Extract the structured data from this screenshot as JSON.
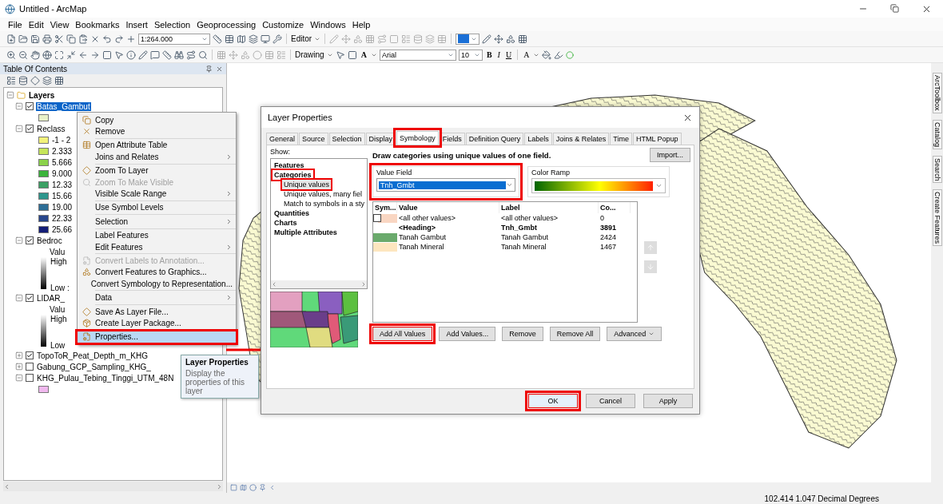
{
  "window": {
    "title": "Untitled - ArcMap"
  },
  "menu_bar": [
    "File",
    "Edit",
    "View",
    "Bookmarks",
    "Insert",
    "Selection",
    "Geoprocessing",
    "Customize",
    "Windows",
    "Help"
  ],
  "standard_toolbar": {
    "scale": "1:264.000",
    "editor": "Editor"
  },
  "drawing_toolbar": {
    "label": "Drawing",
    "text_tool": "A",
    "font": "Arial",
    "size": "10",
    "styles": [
      "B",
      "I",
      "U"
    ],
    "font_color": "A"
  },
  "toc": {
    "title": "Table Of Contents",
    "root": {
      "label": "Layers",
      "expanded": true,
      "children": [
        {
          "label": "Batas_Gambut",
          "checked": true,
          "expanded": true,
          "selected": true,
          "legend": [
            {
              "kind": "swatch",
              "color": "#e8f0c8"
            }
          ]
        },
        {
          "label": "Reclass",
          "checked": true,
          "expanded": true,
          "selected": false,
          "legend": [
            {
              "kind": "swatch",
              "label": "-1 - 2",
              "color": "#f2f27a"
            },
            {
              "kind": "swatch",
              "label": "2.333",
              "color": "#c6e65a"
            },
            {
              "kind": "swatch",
              "label": "5.666",
              "color": "#8ad24a"
            },
            {
              "kind": "swatch",
              "label": "9.000",
              "color": "#3cb43c"
            },
            {
              "kind": "swatch",
              "label": "12.33",
              "color": "#3ca064"
            },
            {
              "kind": "swatch",
              "label": "15.66",
              "color": "#2d968c"
            },
            {
              "kind": "swatch",
              "label": "19.00",
              "color": "#2d6e96"
            },
            {
              "kind": "swatch",
              "label": "22.33",
              "color": "#28468c"
            },
            {
              "kind": "swatch",
              "label": "25.66",
              "color": "#141e78"
            }
          ]
        },
        {
          "label": "Bedroc",
          "checked": true,
          "expanded": true,
          "selected": false,
          "legend": [
            {
              "kind": "ramp",
              "heading": "Valu",
              "high": "High",
              "low": "Low :"
            }
          ]
        },
        {
          "label": "LIDAR_",
          "checked": true,
          "expanded": true,
          "selected": false,
          "legend": [
            {
              "kind": "ramp",
              "heading": "Valu",
              "high": "High",
              "low": "Low"
            }
          ]
        },
        {
          "label": "TopoToR_Peat_Depth_m_KHG",
          "checked": true,
          "expanded": false,
          "selected": false
        },
        {
          "label": "Gabung_GCP_Sampling_KHG_",
          "checked": false,
          "expanded": false,
          "selected": false
        },
        {
          "label": "KHG_Pulau_Tebing_Tinggi_UTM_48N",
          "checked": false,
          "expanded": true,
          "selected": false,
          "legend": [
            {
              "kind": "swatch",
              "color": "#f0b8ee"
            }
          ]
        }
      ]
    }
  },
  "context_menu": [
    {
      "kind": "item",
      "label": "Copy",
      "disabled": false,
      "submenu": false,
      "selected": false,
      "highlighted": false
    },
    {
      "kind": "item",
      "label": "Remove",
      "disabled": false,
      "submenu": false,
      "selected": false,
      "highlighted": false
    },
    {
      "kind": "separator"
    },
    {
      "kind": "item",
      "label": "Open Attribute Table",
      "disabled": false,
      "submenu": false,
      "selected": false,
      "highlighted": false
    },
    {
      "kind": "item",
      "label": "Joins and Relates",
      "disabled": false,
      "submenu": true,
      "selected": false,
      "highlighted": false
    },
    {
      "kind": "separator"
    },
    {
      "kind": "item",
      "label": "Zoom To Layer",
      "disabled": false,
      "submenu": false,
      "selected": false,
      "highlighted": false
    },
    {
      "kind": "item",
      "label": "Zoom To Make Visible",
      "disabled": true,
      "submenu": false,
      "selected": false,
      "highlighted": false
    },
    {
      "kind": "item",
      "label": "Visible Scale Range",
      "disabled": false,
      "submenu": true,
      "selected": false,
      "highlighted": false
    },
    {
      "kind": "separator"
    },
    {
      "kind": "item",
      "label": "Use Symbol Levels",
      "disabled": false,
      "submenu": false,
      "selected": false,
      "highlighted": false
    },
    {
      "kind": "separator"
    },
    {
      "kind": "item",
      "label": "Selection",
      "disabled": false,
      "submenu": true,
      "selected": false,
      "highlighted": false
    },
    {
      "kind": "separator"
    },
    {
      "kind": "item",
      "label": "Label Features",
      "disabled": false,
      "submenu": false,
      "selected": false,
      "highlighted": false
    },
    {
      "kind": "item",
      "label": "Edit Features",
      "disabled": false,
      "submenu": true,
      "selected": false,
      "highlighted": false
    },
    {
      "kind": "separator"
    },
    {
      "kind": "item",
      "label": "Convert Labels to Annotation...",
      "disabled": true,
      "submenu": false,
      "selected": false,
      "highlighted": false
    },
    {
      "kind": "item",
      "label": "Convert Features to Graphics...",
      "disabled": false,
      "submenu": false,
      "selected": false,
      "highlighted": false
    },
    {
      "kind": "item",
      "label": "Convert Symbology to Representation...",
      "disabled": false,
      "submenu": false,
      "selected": false,
      "highlighted": false
    },
    {
      "kind": "separator"
    },
    {
      "kind": "item",
      "label": "Data",
      "disabled": false,
      "submenu": true,
      "selected": false,
      "highlighted": false
    },
    {
      "kind": "separator"
    },
    {
      "kind": "item",
      "label": "Save As Layer File...",
      "disabled": false,
      "submenu": false,
      "selected": false,
      "highlighted": false
    },
    {
      "kind": "item",
      "label": "Create Layer Package...",
      "disabled": false,
      "submenu": false,
      "selected": false,
      "highlighted": false
    },
    {
      "kind": "separator"
    },
    {
      "kind": "item",
      "label": "Properties...",
      "disabled": false,
      "submenu": false,
      "selected": true,
      "highlighted": true
    }
  ],
  "tooltip": {
    "title": "Layer Properties",
    "text": "Display the properties of this layer"
  },
  "dialog": {
    "title": "Layer Properties",
    "tabs": [
      {
        "label": "General",
        "selected": false,
        "highlighted": false
      },
      {
        "label": "Source",
        "selected": false,
        "highlighted": false
      },
      {
        "label": "Selection",
        "selected": false,
        "highlighted": false
      },
      {
        "label": "Display",
        "selected": false,
        "highlighted": false
      },
      {
        "label": "Symbology",
        "selected": true,
        "highlighted": true
      },
      {
        "label": "Fields",
        "selected": false,
        "highlighted": false
      },
      {
        "label": "Definition Query",
        "selected": false,
        "highlighted": false
      },
      {
        "label": "Labels",
        "selected": false,
        "highlighted": false
      },
      {
        "label": "Joins & Relates",
        "selected": false,
        "highlighted": false
      },
      {
        "label": "Time",
        "selected": false,
        "highlighted": false
      },
      {
        "label": "HTML Popup",
        "selected": false,
        "highlighted": false
      }
    ],
    "show_label": "Show:",
    "show_tree": [
      {
        "label": "Features",
        "selected": false,
        "highlighted": false
      },
      {
        "label": "Categories",
        "selected": false,
        "highlighted": true,
        "children": [
          {
            "label": "Unique values",
            "selected": true,
            "highlighted": true
          },
          {
            "label": "Unique values, many fiel",
            "selected": false,
            "highlighted": false
          },
          {
            "label": "Match to symbols in a sty",
            "selected": false,
            "highlighted": false
          }
        ]
      },
      {
        "label": "Quantities",
        "selected": false,
        "highlighted": false
      },
      {
        "label": "Charts",
        "selected": false,
        "highlighted": false
      },
      {
        "label": "Multiple Attributes",
        "selected": false,
        "highlighted": false
      }
    ],
    "description": "Draw categories using unique values of one field.",
    "import_button": "Import...",
    "value_field": {
      "label": "Value Field",
      "value": "Tnh_Gmbt",
      "highlighted": true
    },
    "color_ramp": {
      "label": "Color Ramp"
    },
    "table": {
      "columns": [
        "Sym...",
        "Value",
        "Label",
        "Co..."
      ],
      "rows": [
        {
          "kind": "other",
          "checked": false,
          "color": "#f9d6c2",
          "value": "<all other values>",
          "label": "<all other values>",
          "count": "0"
        },
        {
          "kind": "heading",
          "value": "<Heading>",
          "label": "Tnh_Gmbt",
          "count": "3891"
        },
        {
          "kind": "class",
          "color": "#6aaa6c",
          "value": "Tanah Gambut",
          "label": "Tanah Gambut",
          "count": "2424"
        },
        {
          "kind": "class",
          "color": "#fde6bf",
          "value": "Tanah Mineral",
          "label": "Tanah Mineral",
          "count": "1467"
        }
      ]
    },
    "buttons": [
      {
        "label": "Add All Values",
        "highlighted": true,
        "dropdown": false
      },
      {
        "label": "Add Values...",
        "highlighted": false,
        "dropdown": false
      },
      {
        "label": "Remove",
        "highlighted": false,
        "dropdown": false
      },
      {
        "label": "Remove All",
        "highlighted": false,
        "dropdown": false
      },
      {
        "label": "Advanced",
        "highlighted": false,
        "dropdown": true
      }
    ],
    "footer": [
      {
        "label": "OK",
        "highlighted": true,
        "default": true
      },
      {
        "label": "Cancel",
        "highlighted": false,
        "default": false
      },
      {
        "label": "Apply",
        "highlighted": false,
        "default": false
      }
    ]
  },
  "dock_tabs": [
    "ArcToolbox",
    "Catalog",
    "Search",
    "Create Features"
  ],
  "status_bar": {
    "coordinates": "102.414 1.047 Decimal Degrees"
  }
}
